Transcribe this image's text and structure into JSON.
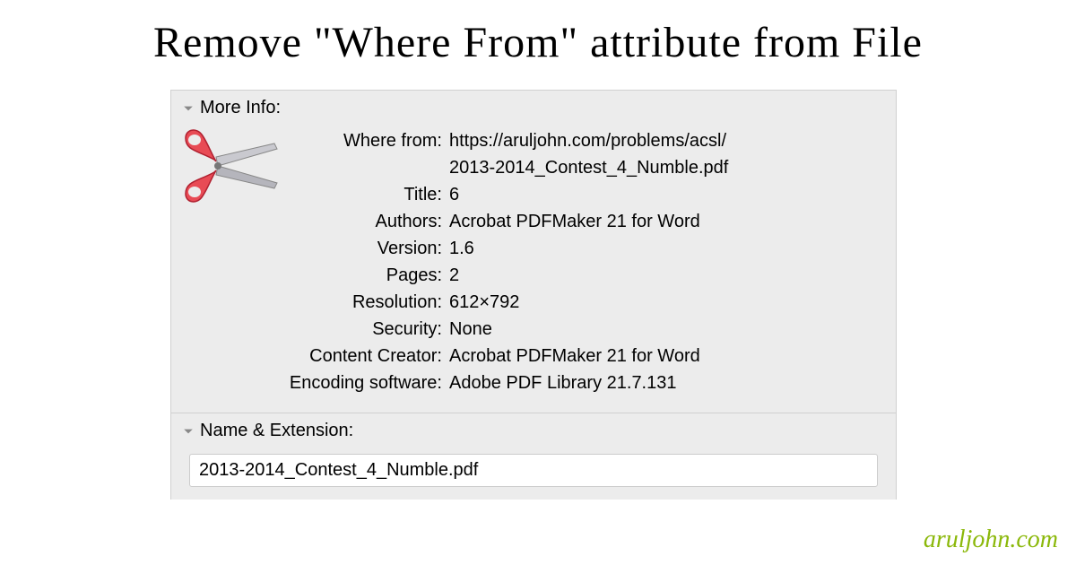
{
  "title": "Remove \"Where From\" attribute from File",
  "more_info": {
    "header": "More Info:",
    "rows": {
      "where_from_label": "Where from:",
      "where_from_value_line1": "https://aruljohn.com/problems/acsl/",
      "where_from_value_line2": "2013-2014_Contest_4_Numble.pdf",
      "title_label": "Title:",
      "title_value": "6",
      "authors_label": "Authors:",
      "authors_value": "Acrobat PDFMaker 21 for Word",
      "version_label": "Version:",
      "version_value": "1.6",
      "pages_label": "Pages:",
      "pages_value": "2",
      "resolution_label": "Resolution:",
      "resolution_value": "612×792",
      "security_label": "Security:",
      "security_value": "None",
      "content_creator_label": "Content Creator:",
      "content_creator_value": "Acrobat PDFMaker 21 for Word",
      "encoding_software_label": "Encoding software:",
      "encoding_software_value": "Adobe PDF Library 21.7.131"
    }
  },
  "name_extension": {
    "header": "Name & Extension:",
    "filename": "2013-2014_Contest_4_Numble.pdf"
  },
  "watermark": "aruljohn.com"
}
